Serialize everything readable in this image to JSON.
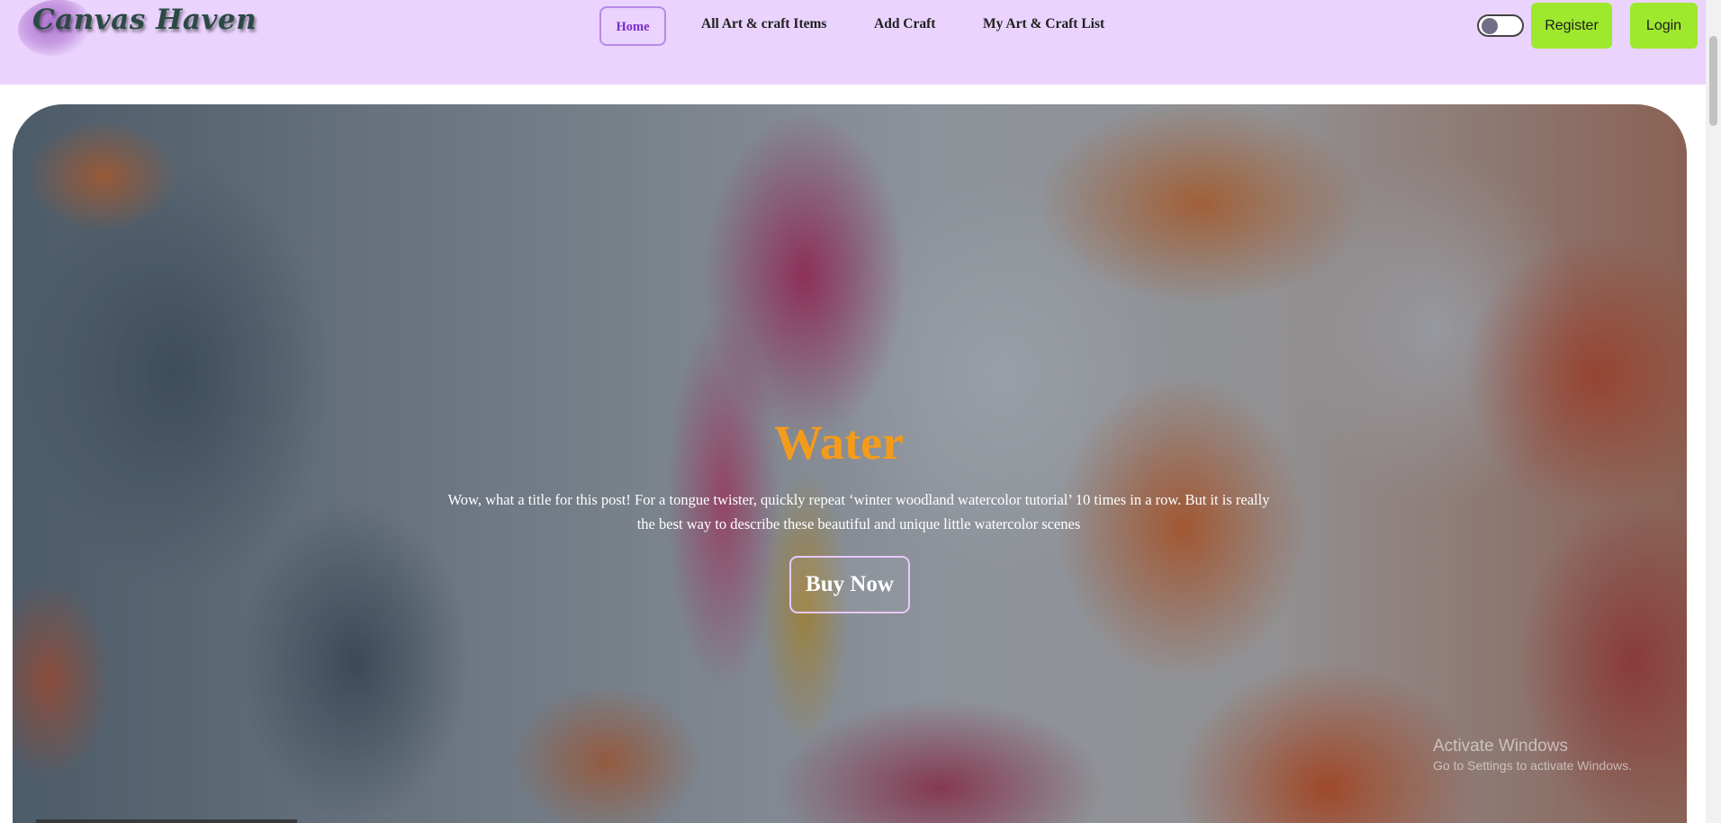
{
  "brand": {
    "logo_text": "Canvas Haven"
  },
  "nav": {
    "items": [
      {
        "label": "Home",
        "active": true
      },
      {
        "label": "All Art & craft Items",
        "active": false
      },
      {
        "label": "Add Craft",
        "active": false
      },
      {
        "label": "My Art & Craft List",
        "active": false
      }
    ]
  },
  "theme_toggle": {
    "state": "off",
    "icon": "toggle-switch"
  },
  "auth": {
    "register_label": "Register",
    "login_label": "Login"
  },
  "hero": {
    "title": "Water",
    "description": "Wow, what a title for this post! For a tongue twister, quickly repeat ‘winter woodland watercolor tutorial’ 10 times in a row. But it is really the best way to describe these beautiful and unique little watercolor scenes",
    "button_label": "Buy Now"
  },
  "watermark": {
    "title": "Activate Windows",
    "subtitle": "Go to Settings to activate Windows."
  },
  "colors": {
    "navbar_bg": "#ead3fc",
    "accent_green": "#9ee82e",
    "active_nav": "#7a2ec9",
    "hero_title": "#f59b1b"
  }
}
